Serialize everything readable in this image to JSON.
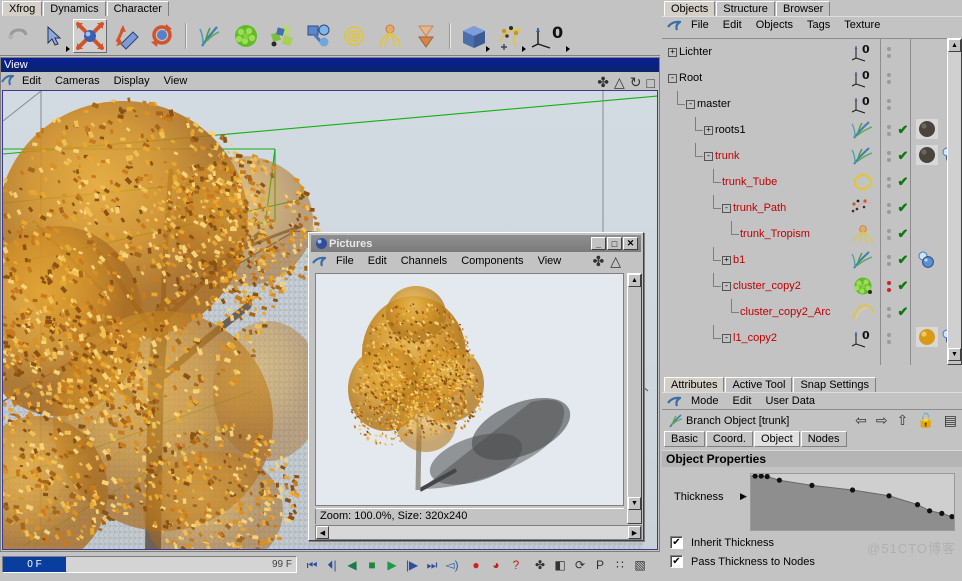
{
  "app": {
    "top_tabs": [
      {
        "label": "Xfrog",
        "active": true
      },
      {
        "label": "Dynamics",
        "active": false
      },
      {
        "label": "Character",
        "active": false
      }
    ],
    "toolbar_icons": [
      {
        "name": "undo-icon",
        "glyph": "↶",
        "selected": false,
        "disabled": true
      },
      {
        "name": "select-arrow-icon",
        "glyph": "➤",
        "selected": false,
        "has_arrow": true
      },
      {
        "name": "move-tool-icon",
        "glyph": "✤",
        "selected": true
      },
      {
        "name": "scale-tool-icon",
        "glyph": "◧",
        "selected": false
      },
      {
        "name": "rotate-tool-icon",
        "glyph": "↻",
        "selected": false
      },
      {
        "name": "xfrog-branch-icon",
        "glyph": "✿",
        "selected": false
      },
      {
        "name": "xfrog-cluster-icon",
        "glyph": "●",
        "selected": false
      },
      {
        "name": "xfrog-leaf-icon",
        "glyph": "■",
        "selected": false
      },
      {
        "name": "xfrog-link-icon",
        "glyph": "⚭",
        "selected": false
      },
      {
        "name": "xfrog-spiral-icon",
        "glyph": "➰",
        "selected": false
      },
      {
        "name": "xfrog-hydra-icon",
        "glyph": "❀",
        "selected": false
      },
      {
        "name": "xfrog-horn-icon",
        "glyph": "▼",
        "selected": false
      },
      {
        "name": "primitive-cube-icon",
        "glyph": "▣",
        "selected": false,
        "has_arrow": true
      },
      {
        "name": "particles-icon",
        "glyph": "✵",
        "selected": false,
        "has_arrow": true
      },
      {
        "name": "axis-zero-icon",
        "glyph": "0",
        "selected": false,
        "has_arrow": true
      }
    ]
  },
  "viewport": {
    "title": "View",
    "menu": [
      "Edit",
      "Cameras",
      "Display",
      "View"
    ],
    "corner_icons": [
      "move-view-icon",
      "scale-view-icon",
      "rotate-view-icon",
      "maximize-view-icon"
    ]
  },
  "pictures_window": {
    "title": "Pictures",
    "menu": [
      "File",
      "Edit",
      "Channels",
      "Components",
      "View"
    ],
    "window_buttons": [
      "minimize",
      "maximize",
      "close"
    ],
    "status": "Zoom: 100.0%, Size: 320x240",
    "toolbar_icons": [
      "move-icon",
      "scale-icon"
    ]
  },
  "timeline": {
    "current_frame": "0 F",
    "end_frame": "99 F",
    "transport": [
      {
        "name": "goto-start-button",
        "glyph": "⏮"
      },
      {
        "name": "step-back-button",
        "glyph": "⏴|"
      },
      {
        "name": "play-back-button",
        "glyph": "◀"
      },
      {
        "name": "stop-button",
        "glyph": "■"
      },
      {
        "name": "play-forward-button",
        "glyph": "▶"
      },
      {
        "name": "step-forward-button",
        "glyph": "|▶"
      },
      {
        "name": "goto-end-button",
        "glyph": "⏭"
      },
      {
        "name": "sound-button",
        "glyph": "◅)"
      },
      {
        "name": "record-button",
        "glyph": "●"
      },
      {
        "name": "autokey-button",
        "glyph": "◕"
      },
      {
        "name": "help-key-button",
        "glyph": "?"
      },
      {
        "name": "key-position-button",
        "glyph": "✤"
      },
      {
        "name": "key-scale-button",
        "glyph": "◧"
      },
      {
        "name": "key-rotation-button",
        "glyph": "⟳"
      },
      {
        "name": "key-parameter-button",
        "glyph": "P"
      },
      {
        "name": "key-points-button",
        "glyph": "∷"
      },
      {
        "name": "key-all-button",
        "glyph": "▧"
      }
    ]
  },
  "object_manager": {
    "tabs": [
      {
        "label": "Objects",
        "active": true
      },
      {
        "label": "Structure",
        "active": false
      },
      {
        "label": "Browser",
        "active": false
      }
    ],
    "menu": [
      "File",
      "Edit",
      "Objects",
      "Tags",
      "Texture"
    ],
    "rows": [
      {
        "label": "Lichter",
        "depth": 0,
        "expander": "+",
        "red": false,
        "icon": "axis-zero-icon",
        "check": false,
        "dots": "gray",
        "tags": []
      },
      {
        "label": "Root",
        "depth": 0,
        "expander": "-",
        "red": false,
        "icon": "axis-zero-icon",
        "check": false,
        "dots": "gray",
        "tags": []
      },
      {
        "label": "master",
        "depth": 1,
        "expander": "-",
        "red": false,
        "icon": "axis-zero-icon",
        "check": false,
        "dots": "gray",
        "tags": []
      },
      {
        "label": "roots1",
        "depth": 2,
        "expander": "+",
        "red": false,
        "icon": "branch-icon",
        "check": true,
        "dots": "gray",
        "tags": [
          "material-dark"
        ]
      },
      {
        "label": "trunk",
        "depth": 2,
        "expander": "-",
        "red": true,
        "icon": "branch-icon",
        "check": true,
        "dots": "gray",
        "tags": [
          "material-dark",
          "uv-tag"
        ]
      },
      {
        "label": "trunk_Tube",
        "depth": 3,
        "expander": "",
        "red": true,
        "icon": "ring-icon",
        "check": true,
        "dots": "gray",
        "tags": []
      },
      {
        "label": "trunk_Path",
        "depth": 3,
        "expander": "-",
        "red": true,
        "icon": "path-icon",
        "check": true,
        "dots": "gray",
        "tags": []
      },
      {
        "label": "trunk_Tropism",
        "depth": 4,
        "expander": "",
        "red": true,
        "icon": "tropism-icon",
        "check": true,
        "dots": "gray",
        "tags": []
      },
      {
        "label": "b1",
        "depth": 3,
        "expander": "+",
        "red": true,
        "icon": "branch-icon",
        "check": true,
        "dots": "gray",
        "tags": [
          "uv-tag"
        ]
      },
      {
        "label": "cluster_copy2",
        "depth": 3,
        "expander": "-",
        "red": true,
        "icon": "cluster-icon",
        "check": true,
        "dots": "red",
        "tags": []
      },
      {
        "label": "cluster_copy2_Arc",
        "depth": 4,
        "expander": "",
        "red": true,
        "icon": "arc-icon",
        "check": true,
        "dots": "gray",
        "tags": []
      },
      {
        "label": "l1_copy2",
        "depth": 3,
        "expander": "-",
        "red": true,
        "icon": "axis-zero-icon",
        "check": false,
        "dots": "gray",
        "tags": [
          "material-gold",
          "uv-tag"
        ]
      }
    ]
  },
  "attributes": {
    "tabs": [
      {
        "label": "Attributes",
        "active": true
      },
      {
        "label": "Active Tool",
        "active": false
      },
      {
        "label": "Snap Settings",
        "active": false
      }
    ],
    "menu": [
      "Mode",
      "Edit",
      "User Data"
    ],
    "object_title": "Branch Object [trunk]",
    "header_icons": [
      "back-arrow-icon",
      "forward-arrow-icon",
      "up-arrow-icon",
      "lock-open-icon",
      "layout-icon"
    ],
    "property_tabs": [
      {
        "label": "Basic",
        "active": false
      },
      {
        "label": "Coord.",
        "active": false
      },
      {
        "label": "Object",
        "active": true
      },
      {
        "label": "Nodes",
        "active": false
      }
    ],
    "section_title": "Object Properties",
    "thickness_label": "Thickness",
    "checkboxes": [
      {
        "label": "Inherit Thickness",
        "checked": true
      },
      {
        "label": "Pass Thickness to Nodes",
        "checked": true
      }
    ]
  },
  "watermark": "@51CTO博客",
  "chart_data": {
    "type": "line",
    "title": "Thickness",
    "x": [
      0.02,
      0.05,
      0.08,
      0.14,
      0.3,
      0.5,
      0.68,
      0.82,
      0.88,
      0.94,
      0.99
    ],
    "values": [
      1.0,
      1.0,
      0.99,
      0.92,
      0.82,
      0.73,
      0.62,
      0.45,
      0.33,
      0.28,
      0.22
    ],
    "xlabel": "",
    "ylabel": "",
    "xlim": [
      0,
      1
    ],
    "ylim": [
      0,
      1
    ],
    "grid": false,
    "fill": true
  },
  "colors": {
    "accent_blue": "#0a246a",
    "panel_gray": "#c3c3c3",
    "tree_red": "#c00000",
    "check_green": "#0b7a0b",
    "helper_green": "#14b014",
    "timeline_blue": "#0a3e9e"
  }
}
